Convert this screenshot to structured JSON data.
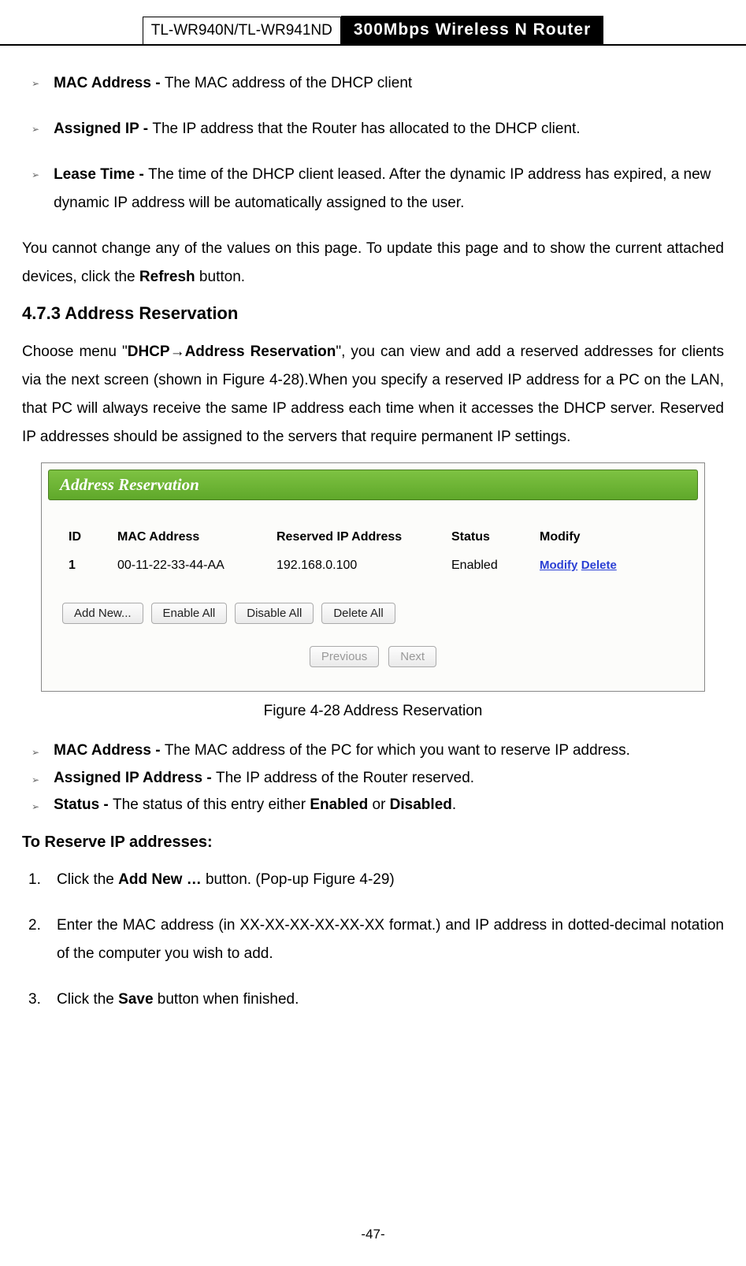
{
  "header": {
    "model": "TL-WR940N/TL-WR941ND",
    "product": "300Mbps Wireless N Router"
  },
  "bulletsTop": [
    {
      "term": "MAC Address - ",
      "desc": "The MAC address of the DHCP client"
    },
    {
      "term": "Assigned IP - ",
      "desc": "The IP address that the Router has allocated to the DHCP client."
    },
    {
      "term": "Lease Time - ",
      "desc": "The time of the DHCP client leased. After the dynamic IP address has expired, a new dynamic IP address will be automatically assigned to the user."
    }
  ],
  "paraRefresh": {
    "pre": "You cannot change any of the values on this page. To update this page and to show the current attached devices, click the ",
    "bold": "Refresh",
    "post": " button."
  },
  "heading": "4.7.3  Address Reservation",
  "paraIntro": {
    "pre": "Choose menu \"",
    "b1": "DHCP",
    "b2": "Address Reservation",
    "mid": "\", you can view and add a reserved addresses for clients via the next screen (shown in ",
    "figref": "Figure 4-28",
    "post": ").When you specify a reserved IP address for a PC on the LAN, that PC will always receive the same IP address each time when it accesses the DHCP server. Reserved IP addresses should be assigned to the servers that require permanent IP settings."
  },
  "figure": {
    "title": "Address Reservation",
    "headers": {
      "id": "ID",
      "mac": "MAC Address",
      "ip": "Reserved IP Address",
      "status": "Status",
      "modify": "Modify"
    },
    "row": {
      "id": "1",
      "mac": "00-11-22-33-44-AA",
      "ip": "192.168.0.100",
      "status": "Enabled",
      "modifyLabel": "Modify",
      "deleteLabel": "Delete"
    },
    "buttons": {
      "addnew": "Add New...",
      "enableall": "Enable All",
      "disableall": "Disable All",
      "deleteall": "Delete All",
      "prev": "Previous",
      "next": "Next"
    },
    "caption": "Figure 4-28    Address Reservation"
  },
  "bulletsBottom": [
    {
      "term": "MAC Address - ",
      "desc": "The MAC address of the PC for which you want to reserve IP address."
    },
    {
      "term": "Assigned IP Address - ",
      "desc": "The IP address of the Router reserved."
    },
    {
      "term": "Status - ",
      "descPre": "The status of this entry either ",
      "b1": "Enabled",
      "mid": " or ",
      "b2": "Disabled",
      "post": "."
    }
  ],
  "howtoTitle": "To Reserve IP addresses:",
  "steps": [
    {
      "num": "1.",
      "pre": "Click the ",
      "bold": "Add New …",
      "mid": " button. (Pop-up ",
      "figref": "Figure 4-29",
      "post": ")"
    },
    {
      "num": "2.",
      "text": "Enter the MAC address (in XX-XX-XX-XX-XX-XX format.) and IP address in dotted-decimal notation of the computer you wish to add."
    },
    {
      "num": "3.",
      "pre": "Click the ",
      "bold": "Save",
      "post": " button when finished."
    }
  ],
  "pageNumber": "-47-"
}
